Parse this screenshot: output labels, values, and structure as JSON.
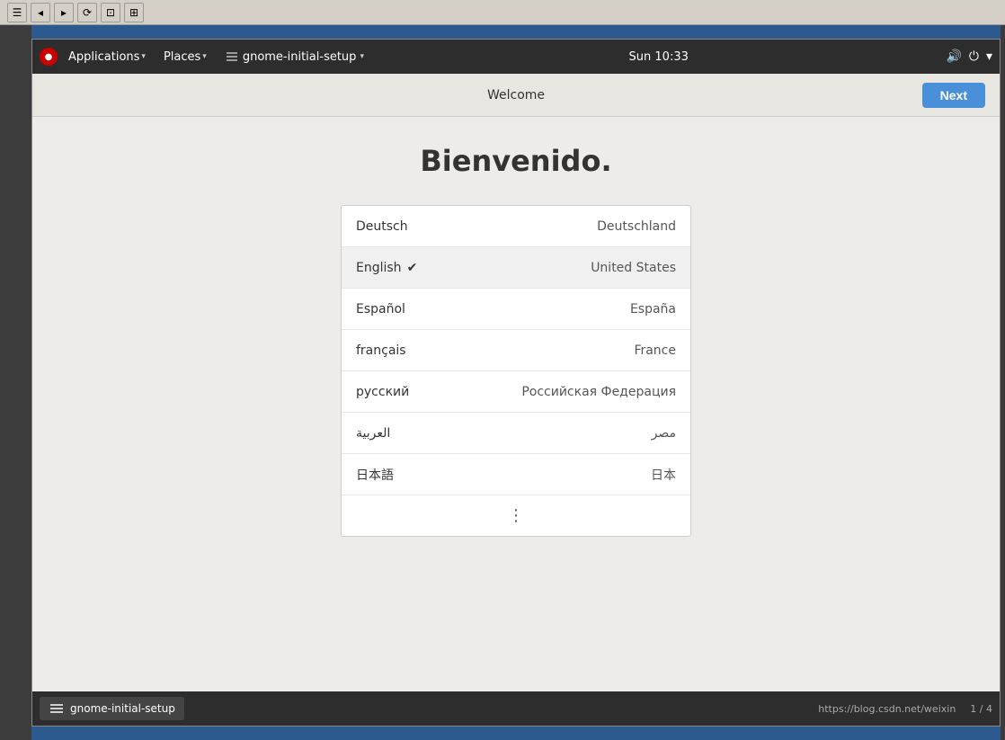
{
  "browser_toolbar": {
    "buttons": [
      "☰",
      "◂",
      "▸",
      "⟳",
      "⊡",
      "⊞"
    ]
  },
  "gnome_topbar": {
    "app_icon": "🔴",
    "menus": [
      {
        "label": "Applications",
        "has_arrow": true
      },
      {
        "label": "Places",
        "has_arrow": true
      },
      {
        "label": "gnome-initial-setup",
        "has_arrow": true
      }
    ],
    "clock": "Sun 10:33",
    "icons": [
      "🔊",
      "⏻"
    ]
  },
  "app_header": {
    "title": "Welcome",
    "next_label": "Next"
  },
  "app_content": {
    "welcome_title": "Bienvenido.",
    "languages": [
      {
        "name": "Deutsch",
        "region": "Deutschland",
        "selected": false
      },
      {
        "name": "English",
        "region": "United States",
        "selected": true
      },
      {
        "name": "Español",
        "region": "España",
        "selected": false
      },
      {
        "name": "français",
        "region": "France",
        "selected": false
      },
      {
        "name": "русский",
        "region": "Российская Федерация",
        "selected": false
      },
      {
        "name": "العربية",
        "region": "مصر",
        "selected": false
      },
      {
        "name": "日本語",
        "region": "日本",
        "selected": false
      }
    ],
    "more_button_label": "⋮"
  },
  "taskbar": {
    "item_label": "gnome-initial-setup",
    "url": "https://blog.csdn.net/weixin",
    "pages": "1 / 4"
  }
}
